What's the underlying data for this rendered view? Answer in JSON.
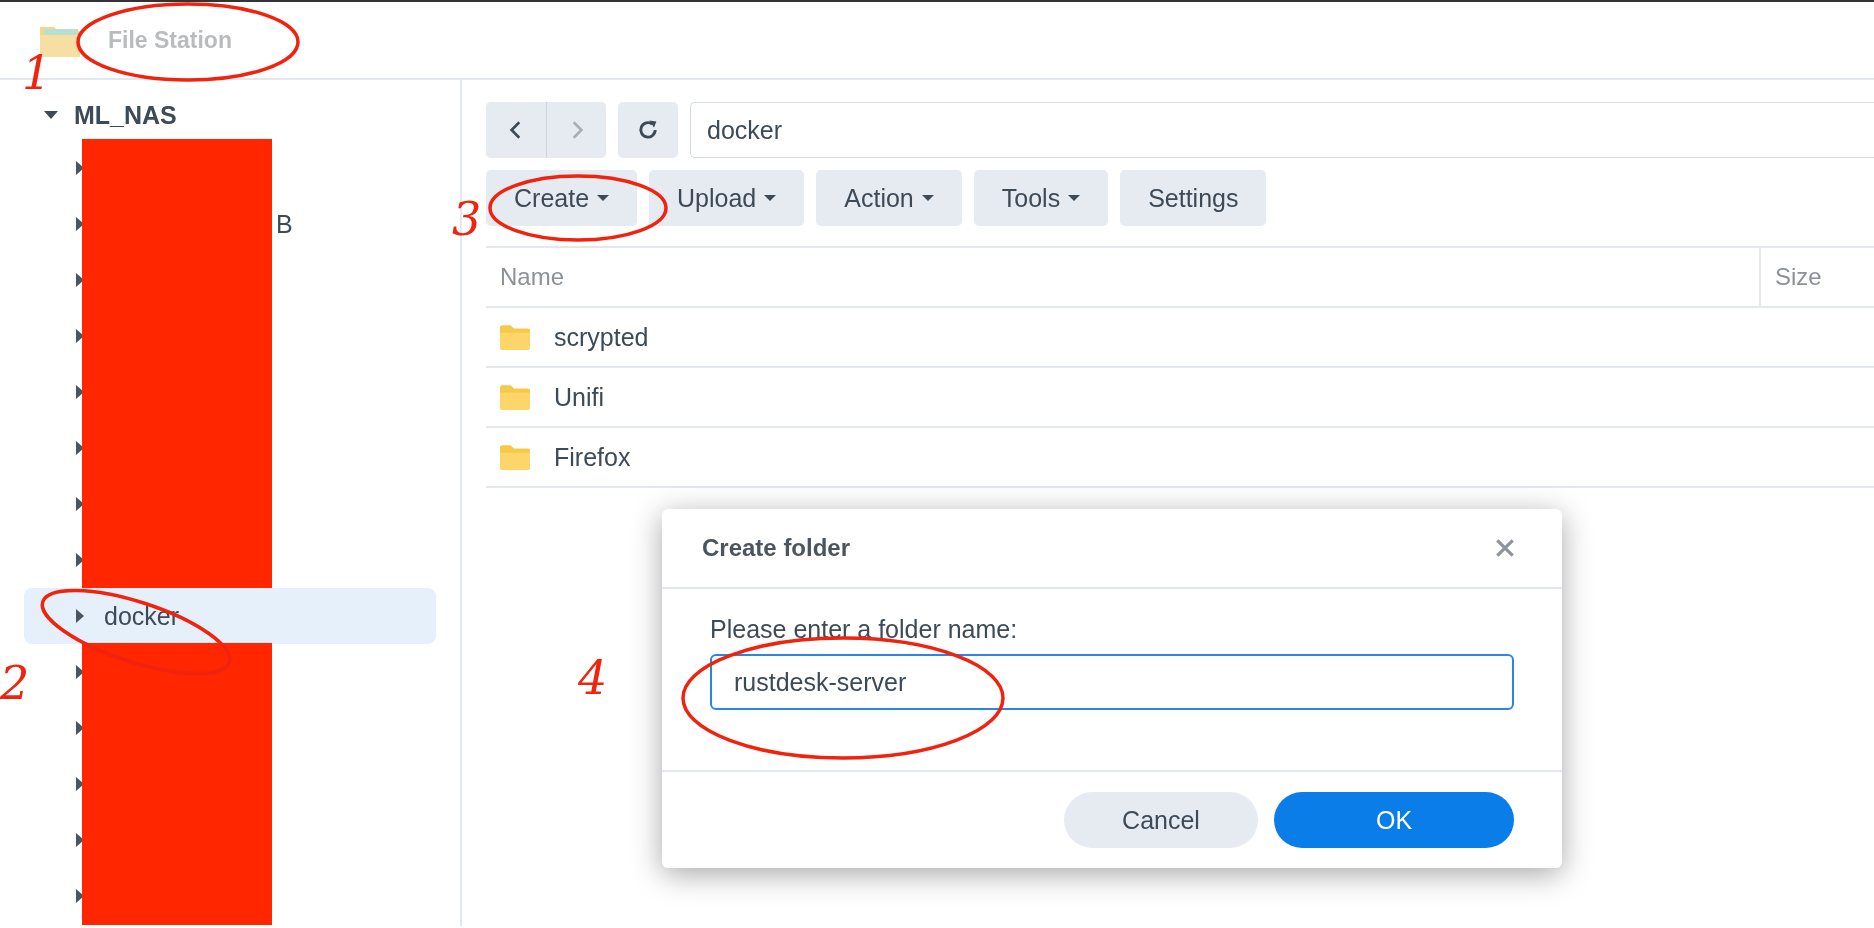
{
  "app": {
    "title": "File Station"
  },
  "tree": {
    "root": {
      "label": "ML_NAS",
      "expanded": true
    },
    "items": [
      {
        "redacted": true,
        "selected": false
      },
      {
        "label": "B",
        "redacted": true,
        "selected": false
      },
      {
        "redacted": true,
        "selected": false
      },
      {
        "redacted": true,
        "selected": false
      },
      {
        "redacted": true,
        "selected": false
      },
      {
        "redacted": true,
        "selected": false
      },
      {
        "redacted": true,
        "selected": false
      },
      {
        "redacted": true,
        "selected": false
      },
      {
        "label": "docker",
        "redacted": false,
        "selected": true
      },
      {
        "redacted": true,
        "selected": false
      },
      {
        "redacted": true,
        "selected": false
      },
      {
        "redacted": true,
        "selected": false
      },
      {
        "redacted": true,
        "selected": false
      },
      {
        "redacted": true,
        "selected": false
      }
    ]
  },
  "path_field": {
    "value": "docker"
  },
  "nav": {
    "back_disabled": false,
    "forward_disabled": true
  },
  "toolbar": [
    {
      "label": "Create",
      "dropdown": true
    },
    {
      "label": "Upload",
      "dropdown": true
    },
    {
      "label": "Action",
      "dropdown": true
    },
    {
      "label": "Tools",
      "dropdown": true
    },
    {
      "label": "Settings",
      "dropdown": false
    }
  ],
  "table": {
    "columns": [
      "Name",
      "Size"
    ],
    "rows": [
      {
        "name": "scrypted"
      },
      {
        "name": "Unifi"
      },
      {
        "name": "Firefox"
      }
    ]
  },
  "dialog": {
    "title": "Create folder",
    "label": "Please enter a folder name:",
    "value": "rustdesk-server",
    "buttons": [
      {
        "label": "Cancel",
        "kind": "secondary"
      },
      {
        "label": "OK",
        "kind": "primary"
      }
    ]
  },
  "annotations": [
    {
      "number": "1"
    },
    {
      "number": "2"
    },
    {
      "number": "3"
    },
    {
      "number": "4"
    }
  ]
}
